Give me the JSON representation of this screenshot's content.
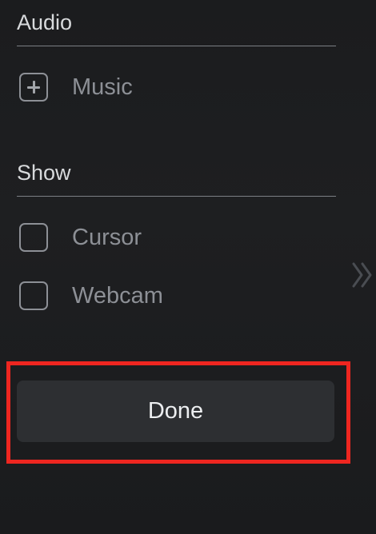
{
  "audio": {
    "title": "Audio",
    "music_label": "Music"
  },
  "show": {
    "title": "Show",
    "items": [
      {
        "label": "Cursor",
        "checked": false
      },
      {
        "label": "Webcam",
        "checked": false
      }
    ]
  },
  "expand": {
    "icon": "double-chevron-right-icon"
  },
  "done_label": "Done",
  "highlight_color": "#ee2620"
}
